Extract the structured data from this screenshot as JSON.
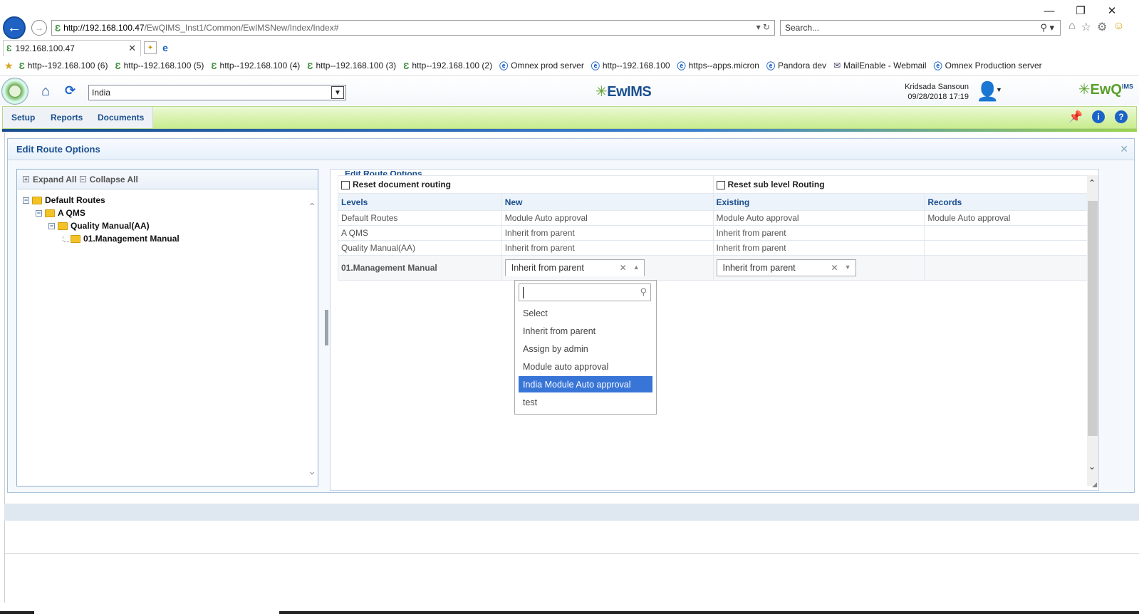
{
  "browser": {
    "window_controls": [
      "—",
      "❐",
      "✕"
    ],
    "address": {
      "host": "http://192.168.100.47",
      "path": "/EwQIMS_Inst1/Common/EwIMSNew/Index/Index#"
    },
    "search_placeholder": "Search...",
    "tab_title": "192.168.100.47",
    "favorites": [
      {
        "label": "http--192.168.100 (6)",
        "icon": "ewims-icon"
      },
      {
        "label": "http--192.168.100 (5)",
        "icon": "ewims-icon"
      },
      {
        "label": "http--192.168.100 (4)",
        "icon": "ewims-icon"
      },
      {
        "label": "http--192.168.100 (3)",
        "icon": "ewims-icon"
      },
      {
        "label": "http--192.168.100 (2)",
        "icon": "ewims-icon"
      },
      {
        "label": "Omnex prod server",
        "icon": "ie-icon"
      },
      {
        "label": "http--192.168.100",
        "icon": "ie-icon"
      },
      {
        "label": "https--apps.micron",
        "icon": "ie-icon"
      },
      {
        "label": "Pandora dev",
        "icon": "ie-icon"
      },
      {
        "label": "MailEnable - Webmail",
        "icon": "mail-icon"
      },
      {
        "label": "Omnex Production server",
        "icon": "ie-icon"
      }
    ]
  },
  "app": {
    "site_select": "India",
    "brand": "EwIMS",
    "brand_right": "EwQ",
    "brand_right_sup": "IMS",
    "user": {
      "name": "Kridsada Sansoun",
      "datetime": "09/28/2018 17:19"
    },
    "menu": [
      "Setup",
      "Reports",
      "Documents"
    ]
  },
  "dialog": {
    "title": "Edit Route Options",
    "tree": {
      "expand_all": "Expand All",
      "collapse_all": "Collapse All",
      "nodes": [
        "Default Routes",
        "A QMS",
        "Quality Manual(AA)",
        "01.Management Manual"
      ]
    },
    "grid": {
      "section_title": "Edit Route Options",
      "reset_document_routing": "Reset document routing",
      "reset_sub_level_routing": "Reset sub level Routing",
      "columns": [
        "Levels",
        "New",
        "Existing",
        "Records"
      ],
      "rows": [
        {
          "level": "Default Routes",
          "new": "Module Auto approval",
          "existing": "Module Auto approval",
          "records": "Module Auto approval"
        },
        {
          "level": "A QMS",
          "new": "Inherit from parent",
          "existing": "Inherit from parent",
          "records": ""
        },
        {
          "level": "Quality Manual(AA)",
          "new": "Inherit from parent",
          "existing": "Inherit from parent",
          "records": ""
        },
        {
          "level": "01.Management Manual",
          "new": "Inherit from parent",
          "existing": "Inherit from parent",
          "records": ""
        }
      ]
    },
    "dropdown": {
      "search_value": "",
      "options": [
        "Select",
        "Inherit from parent",
        "Assign by admin",
        "Module auto approval",
        "India Module Auto approval",
        "test"
      ],
      "highlighted": "India Module Auto approval"
    }
  },
  "colors": {
    "accent": "#1a4f8f",
    "menubar": "#c8ec8d",
    "highlight": "#3875d7"
  }
}
